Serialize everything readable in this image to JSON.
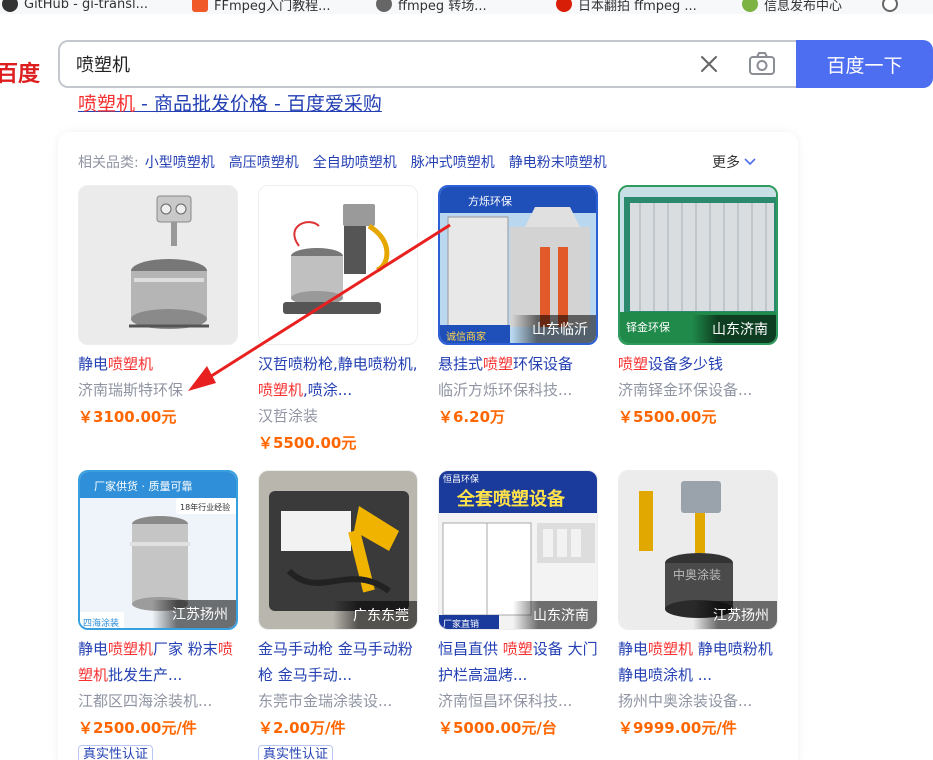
{
  "bookmarks": [
    {
      "label": "GitHub - gi-transl..."
    },
    {
      "label": "FFmpeg入门教程..."
    },
    {
      "label": "ffmpeg 转场..."
    },
    {
      "label": "日本翻拍 ffmpeg ..."
    },
    {
      "label": "信息发布中心"
    }
  ],
  "header": {
    "logo_text": "百度",
    "query": "喷塑机",
    "search_button": "百度一下"
  },
  "result_title": {
    "highlight": "喷塑机",
    "rest": " - 商品批发价格 - 百度爱采购"
  },
  "categories": {
    "label": "相关品类:",
    "items": [
      "小型喷塑机",
      "高压喷塑机",
      "全自助喷塑机",
      "脉冲式喷塑机",
      "静电粉末喷塑机"
    ],
    "more": "更多"
  },
  "products": [
    {
      "title_parts": [
        {
          "t": "静电",
          "hl": false
        },
        {
          "t": "喷塑机",
          "hl": true
        }
      ],
      "shop": "济南瑞斯特环保",
      "price": "￥3100.00元",
      "location": "",
      "badge": ""
    },
    {
      "title_parts": [
        {
          "t": "汉哲喷粉枪,静电喷粉机,",
          "hl": false
        },
        {
          "t": "喷塑机",
          "hl": true
        },
        {
          "t": ",喷涂...",
          "hl": false
        }
      ],
      "shop": "汉哲涂装",
      "price": "￥5500.00元",
      "location": "",
      "badge": ""
    },
    {
      "title_parts": [
        {
          "t": "悬挂式",
          "hl": false
        },
        {
          "t": "喷塑",
          "hl": true
        },
        {
          "t": "环保设备",
          "hl": false
        }
      ],
      "shop": "临沂方烁环保科技...",
      "price": "￥6.20万",
      "location": "山东临沂",
      "badge": ""
    },
    {
      "title_parts": [
        {
          "t": "喷塑",
          "hl": true
        },
        {
          "t": "设备多少钱",
          "hl": false
        }
      ],
      "shop": "济南铎金环保设备...",
      "price": "￥5500.00元",
      "location": "山东济南",
      "badge": ""
    },
    {
      "title_parts": [
        {
          "t": "静电",
          "hl": false
        },
        {
          "t": "喷塑机",
          "hl": true
        },
        {
          "t": "厂家 粉末",
          "hl": false
        },
        {
          "t": "喷塑机",
          "hl": true
        },
        {
          "t": "批发生产...",
          "hl": false
        }
      ],
      "shop": "江都区四海涂装机...",
      "price": "￥2500.00元/件",
      "location": "江苏扬州",
      "badge": "真实性认证"
    },
    {
      "title_parts": [
        {
          "t": "金马手动枪 金马手动粉枪 金马手动...",
          "hl": false
        }
      ],
      "shop": "东莞市金瑞涂装设...",
      "price": "￥2.00万/件",
      "location": "广东东莞",
      "badge": "真实性认证"
    },
    {
      "title_parts": [
        {
          "t": "恒昌直供 ",
          "hl": false
        },
        {
          "t": "喷塑",
          "hl": true
        },
        {
          "t": "设备 大门护栏高温烤...",
          "hl": false
        }
      ],
      "shop": "济南恒昌环保科技...",
      "price": "￥5000.00元/台",
      "location": "山东济南",
      "badge": ""
    },
    {
      "title_parts": [
        {
          "t": "静电",
          "hl": false
        },
        {
          "t": "喷塑机",
          "hl": true
        },
        {
          "t": " 静电喷粉机 静电喷涂机 ...",
          "hl": false
        }
      ],
      "shop": "扬州中奥涂装设备...",
      "price": "￥9999.00元/件",
      "location": "江苏扬州",
      "badge": ""
    }
  ],
  "image_texts": {
    "p3_brand": "方烁环保",
    "p3_bottom": "诚信商家",
    "p4_side": "铎金环保",
    "p5_banner": "厂家供货 · 质量可靠",
    "p5_years": "18年行业经验",
    "p5_corner": "四海涂装",
    "p7_top": "恒昌环保",
    "p7_banner": "全套喷塑设备",
    "p7_sub": "厂家直销",
    "p8_watermark": "中奥涂装"
  },
  "colors": {
    "link": "#2440b3",
    "highlight": "#f73131",
    "price": "#ff6600",
    "search_button": "#4e6ef2",
    "arrow": "#e8201f"
  }
}
